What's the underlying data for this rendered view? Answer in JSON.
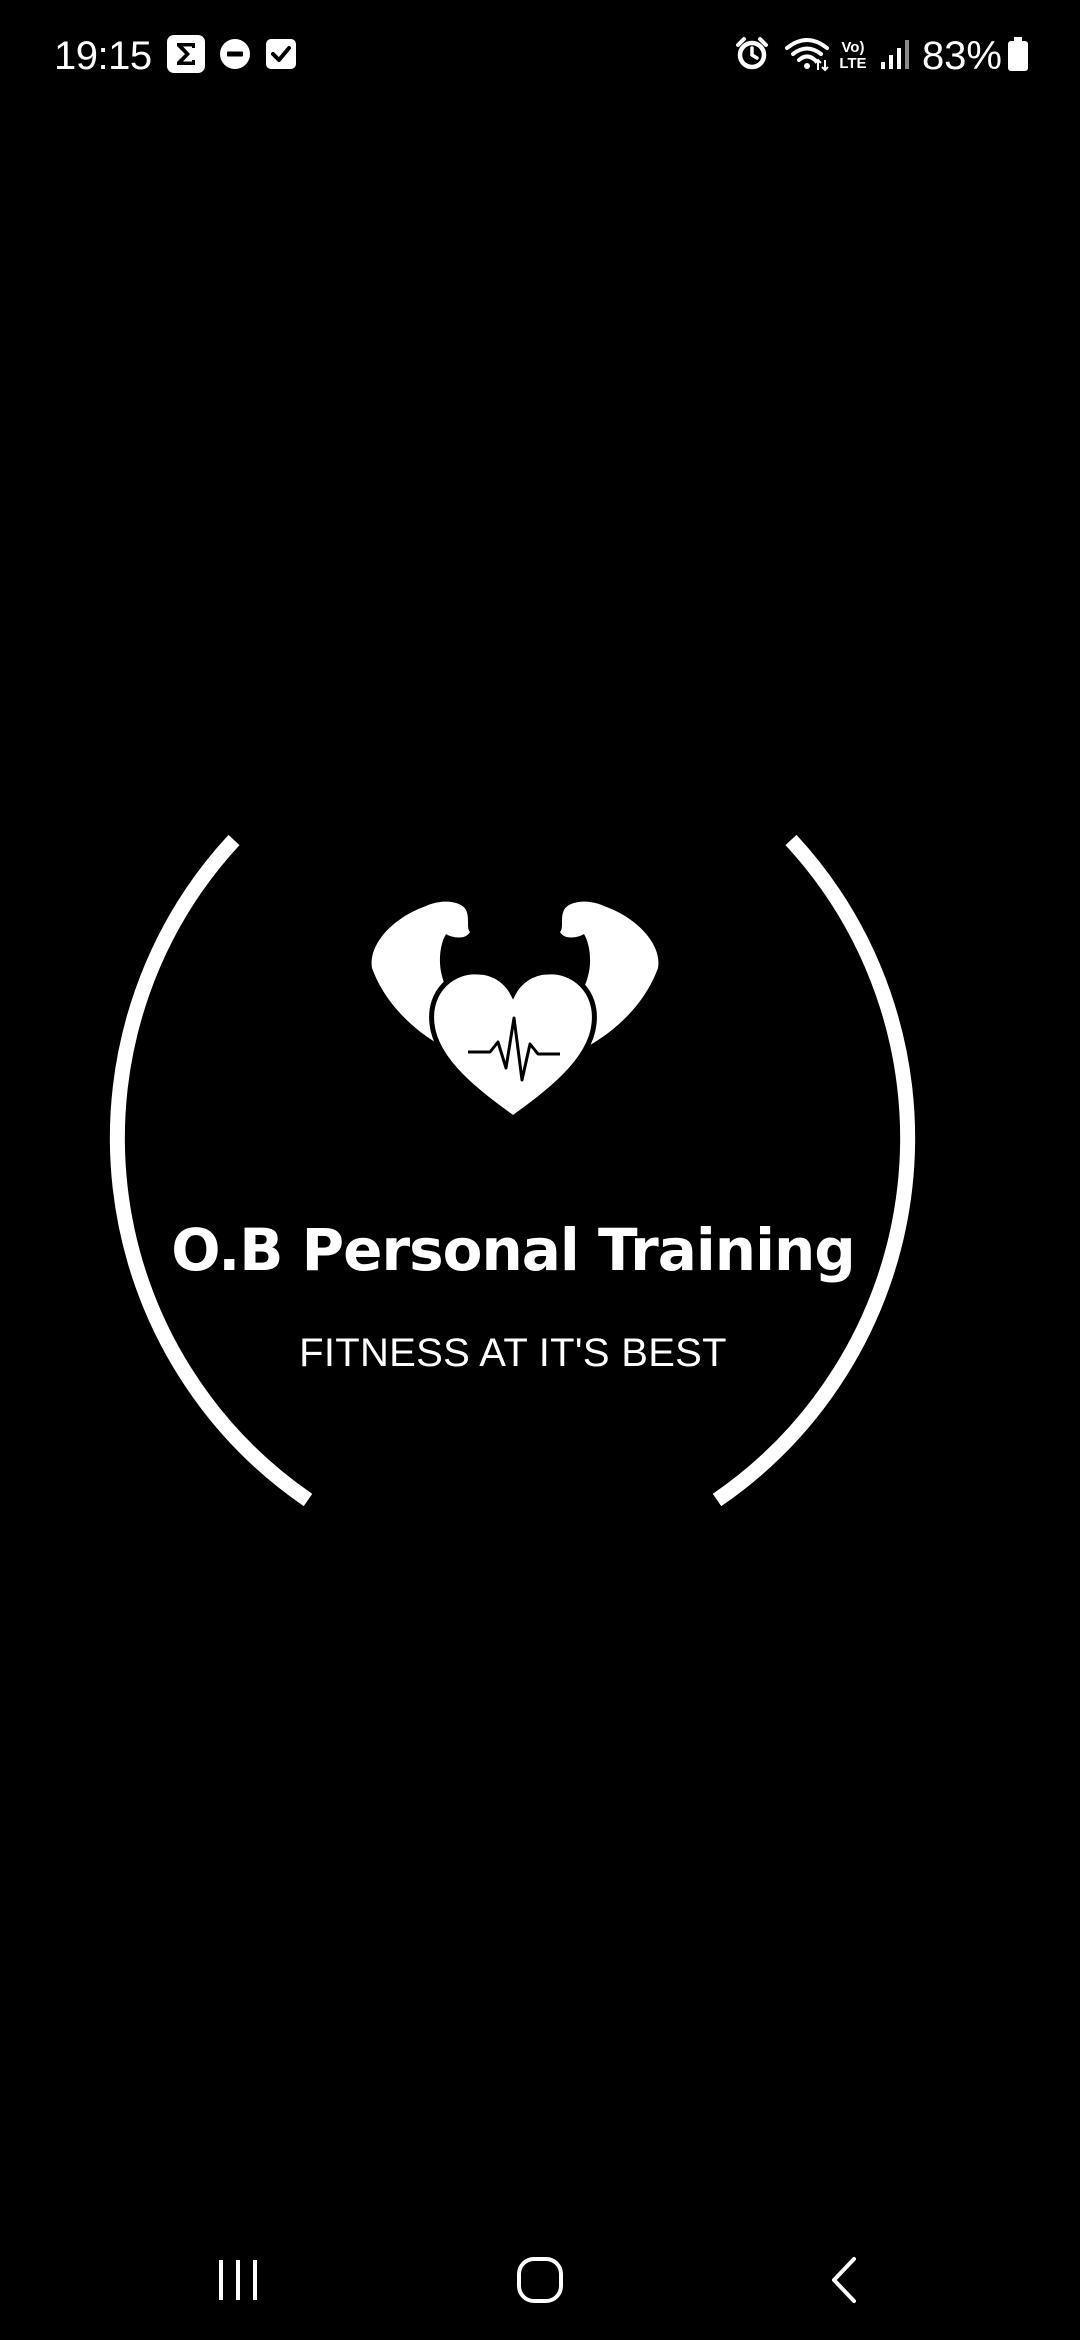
{
  "status_bar": {
    "time": "19:15",
    "battery_percent": "83%",
    "battery_level": 0.83,
    "network_label_top": "Vo)",
    "network_label_bottom": "LTE",
    "icons": [
      "sigma-app-icon",
      "do-not-disturb-icon",
      "checkbox-app-icon",
      "alarm-icon",
      "wifi-icon",
      "volte-lte-icon",
      "cellular-signal-icon",
      "battery-icon"
    ]
  },
  "splash": {
    "brand_name": "O.B Personal Training",
    "tagline": "FITNESS AT IT'S BEST",
    "logo_icon": "flexing-heart-icon"
  },
  "nav_bar": {
    "buttons": [
      "recents-icon",
      "home-icon",
      "back-icon"
    ]
  },
  "colors": {
    "background": "#000000",
    "foreground": "#ffffff"
  }
}
